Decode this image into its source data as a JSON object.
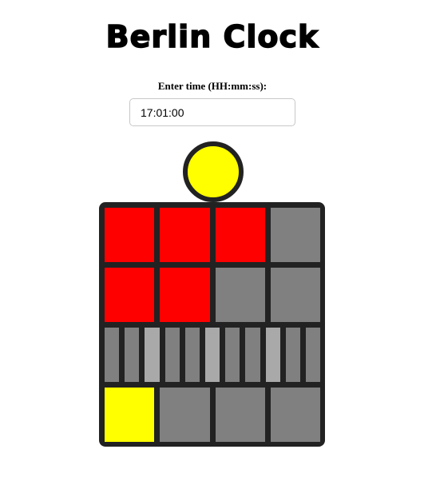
{
  "header": {
    "title": "Berlin Clock"
  },
  "time_entry": {
    "label": "Enter time (HH:mm:ss):",
    "value": "17:01:00"
  },
  "colors": {
    "on_red": "#ff0000",
    "on_yellow": "#ffff00",
    "off": "#808080",
    "off_light": "#a9a9a9",
    "frame": "#222222"
  },
  "clock": {
    "seconds_lamp": "on",
    "five_hour_row": [
      "on",
      "on",
      "on",
      "off"
    ],
    "one_hour_row": [
      "on",
      "on",
      "off",
      "off"
    ],
    "five_minute_row": [
      "off",
      "off",
      "off",
      "off",
      "off",
      "off",
      "off",
      "off",
      "off",
      "off",
      "off"
    ],
    "one_minute_row": [
      "on",
      "off",
      "off",
      "off"
    ]
  }
}
